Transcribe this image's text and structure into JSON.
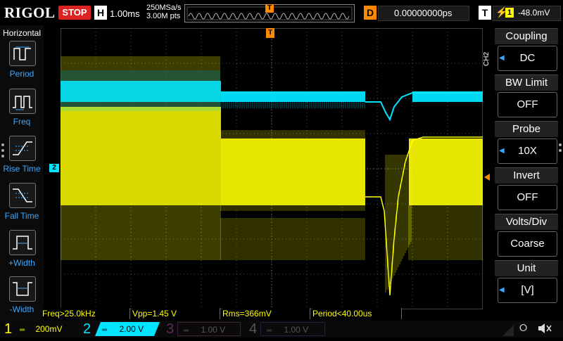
{
  "topbar": {
    "brand": "RIGOL",
    "run_status": "STOP",
    "timebase_mode": "H",
    "timebase_value": "1.00ms",
    "sample_rate": "250MSa/s",
    "memory_depth": "3.00M pts",
    "delay_label": "D",
    "delay_value": "0.00000000ps",
    "trigger_mode": "T",
    "trigger_source": "1",
    "trigger_level": "-48.0mV",
    "trigger_marker": "T"
  },
  "colors": {
    "ch1": "#ffff00",
    "ch2": "#00e5ff",
    "ch3": "#d020d0",
    "ch4": "#3060ff",
    "accent": "#3ba8ff",
    "stop": "#dd2222",
    "trigger_marker": "#ff8a00"
  },
  "left_menu": {
    "title": "Horizontal",
    "items": [
      {
        "label": "Period",
        "icon": "period-icon"
      },
      {
        "label": "Freq",
        "icon": "freq-icon"
      },
      {
        "label": "Rise Time",
        "icon": "rise-time-icon"
      },
      {
        "label": "Fall Time",
        "icon": "fall-time-icon"
      },
      {
        "label": "+Width",
        "icon": "positive-width-icon"
      },
      {
        "label": "-Width",
        "icon": "negative-width-icon"
      }
    ]
  },
  "right_menu": {
    "channel_tag": "CH2",
    "items": [
      {
        "header": "Coupling",
        "value": "DC"
      },
      {
        "header": "BW Limit",
        "value": "OFF"
      },
      {
        "header": "Probe",
        "value": "10X"
      },
      {
        "header": "Invert",
        "value": "OFF"
      },
      {
        "header": "Volts/Div",
        "value": "Coarse"
      },
      {
        "header": "Unit",
        "value": "[V]"
      }
    ]
  },
  "markers": {
    "ch2_ground": "2"
  },
  "measurements": [
    "Freq>25.0kHz",
    "Vpp=1.45 V",
    "Rms=366mV",
    "Period<40.00us"
  ],
  "channels": [
    {
      "number": "1",
      "scale": "200mV",
      "active": true
    },
    {
      "number": "2",
      "scale": "2.00 V",
      "active": true
    },
    {
      "number": "3",
      "scale": "1.00 V",
      "active": false
    },
    {
      "number": "4",
      "scale": "1.00 V",
      "active": false
    }
  ]
}
